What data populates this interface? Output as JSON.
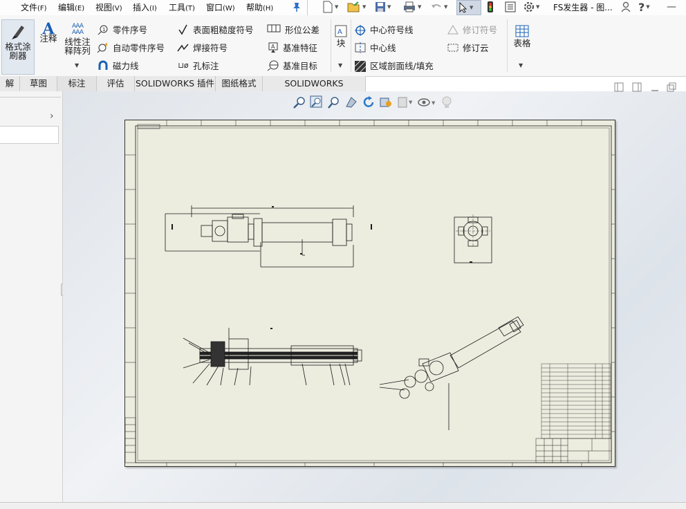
{
  "menu": {
    "items": [
      {
        "label": "文件",
        "key": "(F)"
      },
      {
        "label": "编辑",
        "key": "(E)"
      },
      {
        "label": "视图",
        "key": "(V)"
      },
      {
        "label": "插入",
        "key": "(I)"
      },
      {
        "label": "工具",
        "key": "(T)"
      },
      {
        "label": "窗口",
        "key": "(W)"
      },
      {
        "label": "帮助",
        "key": "(H)"
      }
    ],
    "window_title": "FS发生器 - 图..."
  },
  "ribbon": {
    "format_painter": "格式涂\n刷器",
    "annotation": "注释",
    "linear_note_pattern": "线性注\n释阵列",
    "balloon": "零件序号",
    "auto_balloon": "自动零件序号",
    "magnetic_line": "磁力线",
    "surface_finish": "表面粗糙度符号",
    "weld_symbol": "焊接符号",
    "hole_callout": "孔标注",
    "geometric_tolerance": "形位公差",
    "datum_feature": "基准特征",
    "datum_target": "基准目标",
    "block": "块",
    "center_mark": "中心符号线",
    "centerline": "中心线",
    "area_hatch": "区域剖面线/填充",
    "revision_symbol": "修订符号",
    "revision_cloud": "修订云",
    "table": "表格"
  },
  "tabs": [
    "解",
    "草图",
    "标注",
    "评估",
    "SOLIDWORKS 插件",
    "图纸格式",
    "SOLIDWORKS Inspection"
  ],
  "colors": {
    "sheet": "#ececdf",
    "active_tab": "#e3e3e3",
    "accent_blue": "#1a5fb4",
    "drawing_line": "#1a1a1a"
  }
}
